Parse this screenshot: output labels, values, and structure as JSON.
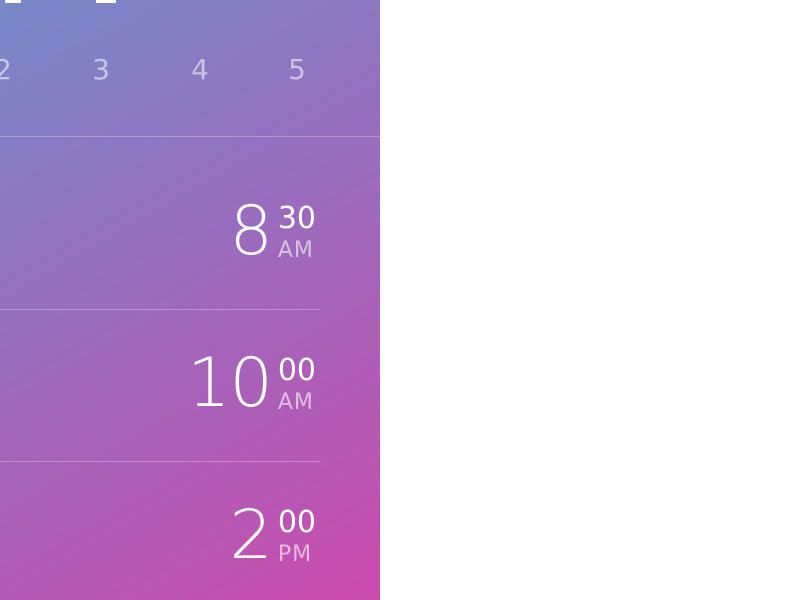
{
  "colors": {
    "gradient_start": "#7888c8",
    "gradient_end": "#cc4aad",
    "text": "#ffffff"
  },
  "days": [
    "2",
    "3",
    "4",
    "5"
  ],
  "slots": [
    {
      "hour": "8",
      "minutes": "30",
      "period": "AM"
    },
    {
      "hour": "10",
      "minutes": "00",
      "period": "AM"
    },
    {
      "hour": "2",
      "minutes": "00",
      "period": "PM"
    }
  ]
}
